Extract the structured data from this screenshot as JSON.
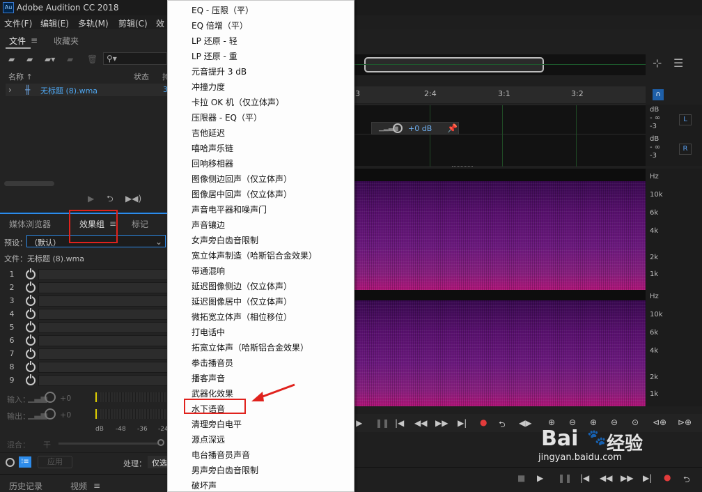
{
  "app": {
    "title": "Adobe Audition CC 2018",
    "logo": "Au"
  },
  "menubar": [
    "文件(F)",
    "编辑(E)",
    "多轨(M)",
    "剪辑(C)",
    "效"
  ],
  "files_panel": {
    "tabs": [
      "文件",
      "收藏夹"
    ],
    "columns": [
      "名称",
      "状态",
      "持"
    ],
    "file": "无标题 (8).wma",
    "col_value": "3"
  },
  "effects_panel": {
    "tabs": [
      "媒体浏览器",
      "效果组",
      "标记"
    ],
    "preset_label": "预设：",
    "preset_value": "（默认）",
    "file_label": "文件：无标题 (8).wma",
    "slots": [
      "1",
      "2",
      "3",
      "4",
      "5",
      "6",
      "7",
      "8",
      "9"
    ],
    "input_label": "输入：",
    "output_label": "输出：",
    "in_db": "+0",
    "out_db": "+0",
    "meter_ticks": [
      "dB",
      "-48",
      "-36",
      "-24"
    ],
    "mix_label": "混合：",
    "mix_dry": "干",
    "apply": "应用",
    "process_label": "处理：",
    "process_value": "仅选"
  },
  "bottom_tabs": [
    "历史记录",
    "视频"
  ],
  "context_menu": {
    "items": [
      "EQ - 压限（平）",
      "EQ 倍增（平）",
      "LP 还原 - 轻",
      "LP 还原 - 重",
      "元音提升 3 dB",
      "冲撞力度",
      "卡拉 OK 机（仅立体声）",
      "压限器 - EQ（平）",
      "吉他延迟",
      "嘻哈声乐链",
      "回响移相器",
      "图像侧边回声（仅立体声）",
      "图像居中回声（仅立体声）",
      "声音电平器和噪声门",
      "声音镶边",
      "女声旁白齿音限制",
      "宽立体声制造（哈斯铝合金效果）",
      "带通混响",
      "延迟图像侧边（仅立体声）",
      "延迟图像居中（仅立体声）",
      "微拓宽立体声（相位移位）",
      "打电话中",
      "拓宽立体声（哈斯铝合金效果）",
      "拳击播音员",
      "播客声音",
      "武器化效果",
      "水下语音",
      "清理旁白电平",
      "源点深远",
      "电台播音员声音",
      "男声旁白齿音限制",
      "破坏声"
    ],
    "highlighted": "水下语音"
  },
  "editor": {
    "timeline": [
      "3",
      "2:4",
      "3:1",
      "3:2"
    ],
    "volume": "+0 dB",
    "channels": [
      "L",
      "R"
    ],
    "db_labels": [
      "dB",
      "- ∞",
      "-3"
    ],
    "hz_labels": [
      "Hz",
      "10k",
      "6k",
      "4k",
      "2k",
      "1k"
    ]
  },
  "watermark": {
    "brand": "Bai",
    "paw": "du",
    "cn": "经验",
    "url": "jingyan.baidu.com"
  },
  "colors": {
    "highlight_box": "#e0221d",
    "accent": "#2d8ceb",
    "record": "#e23b3b"
  }
}
